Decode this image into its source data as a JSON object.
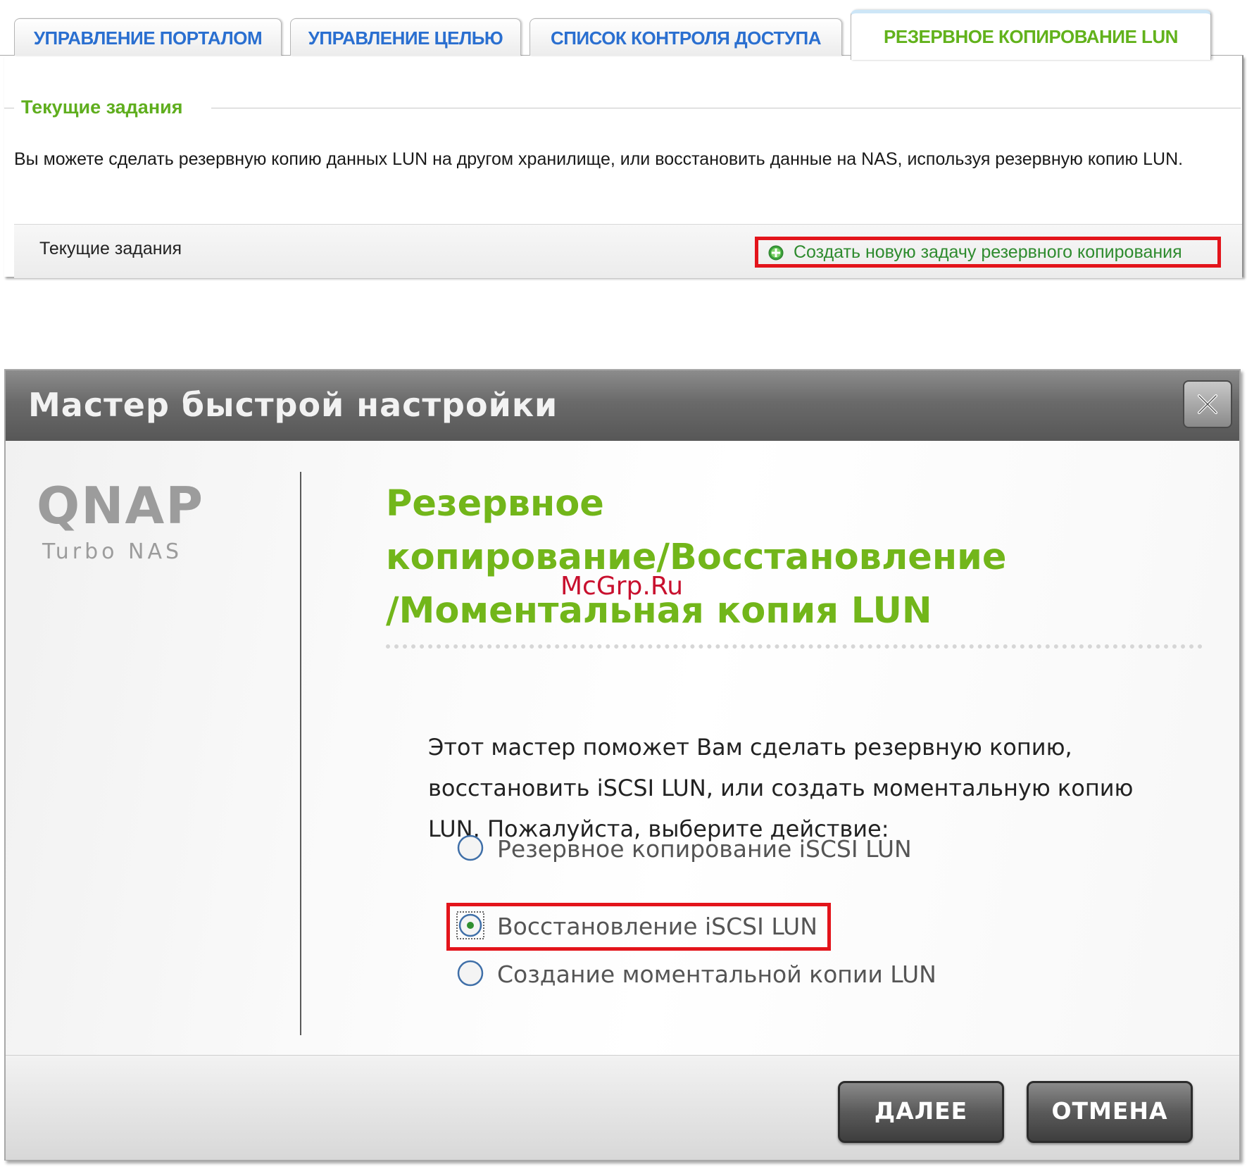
{
  "tabs": [
    {
      "label": "УПРАВЛЕНИЕ ПОРТАЛОМ",
      "active": false
    },
    {
      "label": "УПРАВЛЕНИЕ ЦЕЛЬЮ",
      "active": false
    },
    {
      "label": "СПИСОК КОНТРОЛЯ ДОСТУПА",
      "active": false
    },
    {
      "label": "РЕЗЕРВНОЕ КОПИРОВАНИЕ LUN",
      "active": true
    }
  ],
  "panel": {
    "legend": "Текущие задания",
    "description": "Вы можете сделать резервную копию данных LUN на другом хранилище, или восстановить данные на NAS, используя резервную копию LUN.",
    "jobs_label": "Текущие задания",
    "create_link": "Создать новую задачу резервного копирования",
    "create_icon": "plus-circle-icon"
  },
  "wizard": {
    "title": "Мастер быстрой настройки",
    "close_icon": "close-icon",
    "logo_main": "QNAP",
    "logo_sub": "Turbo NAS",
    "heading_line1": "Резервное",
    "heading_line2": "копирование/Восстановление",
    "heading_line3": "/Моментальная копия LUN",
    "watermark": "McGrp.Ru",
    "intro": "Этот мастер поможет Вам сделать резервную копию, восстановить iSCSI LUN, или создать моментальную копию LUN. Пожалуйста, выберите действие:",
    "options": [
      {
        "label": "Резервное копирование iSCSI LUN",
        "selected": false
      },
      {
        "label": "Восстановление iSCSI LUN",
        "selected": true
      },
      {
        "label": "Создание моментальной копии LUN",
        "selected": false
      }
    ],
    "next_button": "ДАЛЕЕ",
    "cancel_button": "ОТМЕНА"
  },
  "colors": {
    "accent_green": "#72b61a",
    "tab_blue": "#2a6fd0",
    "highlight_red": "#e3141b",
    "header_gray": "#6a6a6a"
  }
}
